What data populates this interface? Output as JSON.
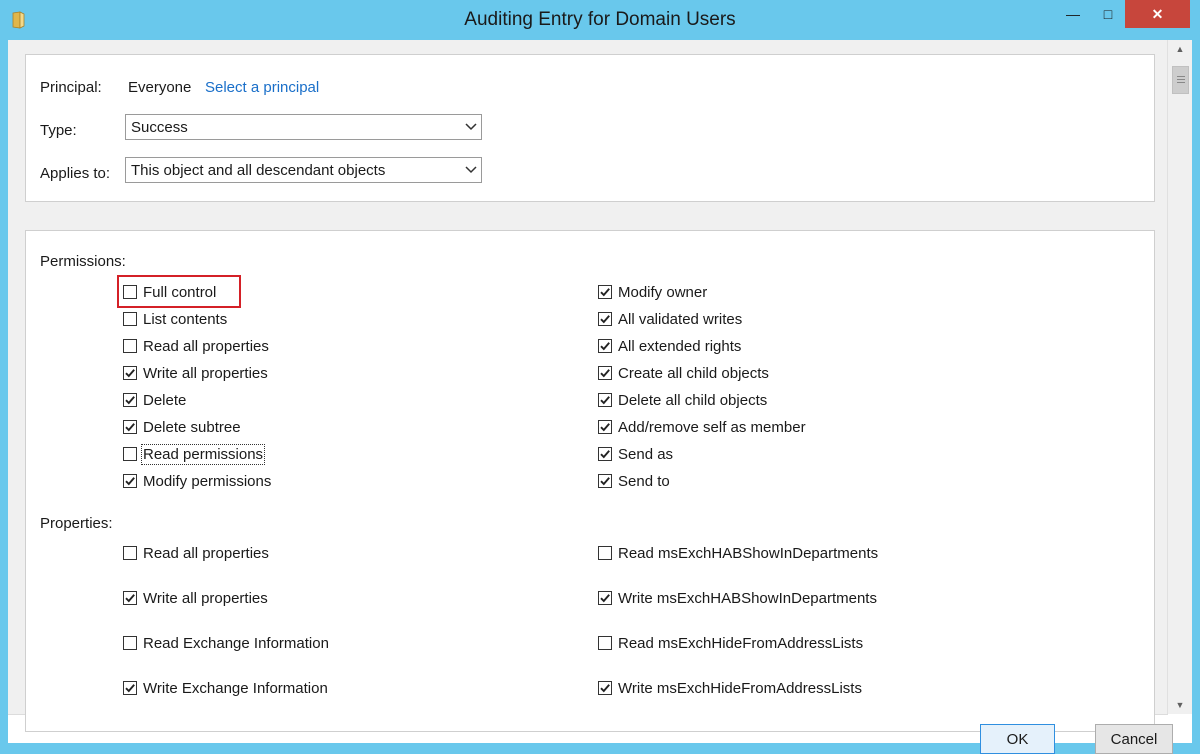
{
  "window": {
    "title": "Auditing Entry for Domain Users",
    "min_glyph": "—",
    "max_glyph": "□",
    "close_glyph": "✕"
  },
  "principal": {
    "label": "Principal:",
    "value": "Everyone",
    "link": "Select a principal"
  },
  "type": {
    "label": "Type:",
    "value": "Success"
  },
  "applies_to": {
    "label": "Applies to:",
    "value": "This object and all descendant objects"
  },
  "permissions": {
    "heading": "Permissions:",
    "left": [
      {
        "label": "Full control",
        "checked": false
      },
      {
        "label": "List contents",
        "checked": false
      },
      {
        "label": "Read all properties",
        "checked": false
      },
      {
        "label": "Write all properties",
        "checked": true
      },
      {
        "label": "Delete",
        "checked": true
      },
      {
        "label": "Delete subtree",
        "checked": true
      },
      {
        "label": "Read permissions",
        "checked": false
      },
      {
        "label": "Modify permissions",
        "checked": true
      }
    ],
    "right": [
      {
        "label": "Modify owner",
        "checked": true
      },
      {
        "label": "All validated writes",
        "checked": true
      },
      {
        "label": "All extended rights",
        "checked": true
      },
      {
        "label": "Create all child objects",
        "checked": true
      },
      {
        "label": "Delete all child objects",
        "checked": true
      },
      {
        "label": "Add/remove self as member",
        "checked": true
      },
      {
        "label": "Send as",
        "checked": true
      },
      {
        "label": "Send to",
        "checked": true
      }
    ]
  },
  "properties": {
    "heading": "Properties:",
    "left": [
      {
        "label": "Read all properties",
        "checked": false
      },
      {
        "label": "Write all properties",
        "checked": true
      },
      {
        "label": "Read Exchange Information",
        "checked": false
      },
      {
        "label": "Write Exchange Information",
        "checked": true
      }
    ],
    "right": [
      {
        "label": "Read msExchHABShowInDepartments",
        "checked": false
      },
      {
        "label": "Write msExchHABShowInDepartments",
        "checked": true
      },
      {
        "label": "Read msExchHideFromAddressLists",
        "checked": false
      },
      {
        "label": "Write msExchHideFromAddressLists",
        "checked": true
      }
    ]
  },
  "buttons": {
    "ok": "OK",
    "cancel": "Cancel"
  },
  "colors": {
    "titlebar": "#69c8ec",
    "close": "#c7463c",
    "link": "#1a6fc9",
    "highlight": "#d42027"
  }
}
